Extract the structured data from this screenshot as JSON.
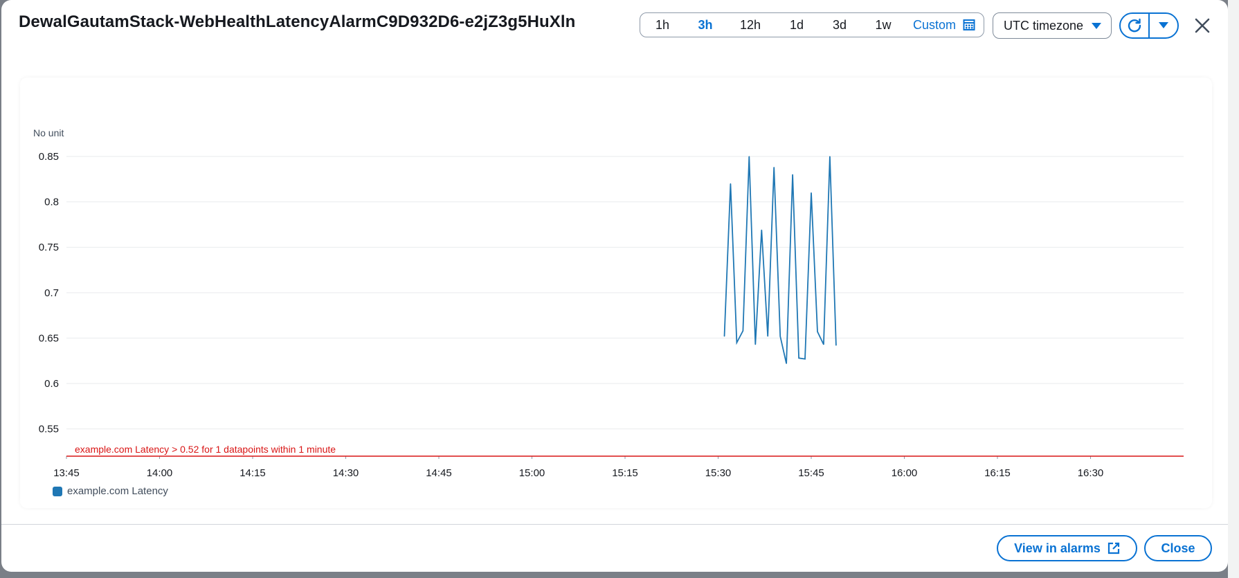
{
  "window": {
    "title": "DewalGautamStack-WebHealthLatencyAlarmC9D932D6-e2jZ3g5HuXln"
  },
  "toolbar": {
    "ranges": [
      "1h",
      "3h",
      "12h",
      "1d",
      "3d",
      "1w"
    ],
    "active_range": "3h",
    "custom_label": "Custom",
    "timezone_label": "UTC timezone",
    "icons": [
      "calendar-icon",
      "caret-down-icon",
      "refresh-icon",
      "close-icon",
      "external-link-icon"
    ]
  },
  "colors": {
    "accent": "#0972d3",
    "series": "#1f77b4",
    "threshold": "#d91515"
  },
  "footer": {
    "view_in_alarms_label": "View in alarms",
    "close_label": "Close"
  },
  "chart_data": {
    "type": "line",
    "ylabel": "No unit",
    "ylim": [
      0.52,
      0.85
    ],
    "yticks": [
      "0.85",
      "0.8",
      "0.75",
      "0.7",
      "0.65",
      "0.6",
      "0.55"
    ],
    "xlim": [
      "13:45",
      "16:45"
    ],
    "xticks": [
      "13:45",
      "14:00",
      "14:15",
      "14:30",
      "14:45",
      "15:00",
      "15:15",
      "15:30",
      "15:45",
      "16:00",
      "16:15",
      "16:30"
    ],
    "grid": true,
    "legend_position": "bottom-left",
    "series": [
      {
        "name": "example.com Latency",
        "x": [
          "15:31",
          "15:32",
          "15:33",
          "15:34",
          "15:35",
          "15:36",
          "15:37",
          "15:38",
          "15:39",
          "15:40",
          "15:41",
          "15:42",
          "15:43",
          "15:44",
          "15:45",
          "15:46",
          "15:47",
          "15:48",
          "15:49"
        ],
        "values": [
          0.652,
          0.82,
          0.645,
          0.658,
          0.85,
          0.643,
          0.769,
          0.652,
          0.838,
          0.652,
          0.622,
          0.83,
          0.628,
          0.627,
          0.81,
          0.657,
          0.643,
          0.85,
          0.642
        ]
      }
    ],
    "threshold": {
      "value": 0.52,
      "label": "example.com Latency > 0.52 for 1 datapoints within 1 minute"
    }
  }
}
